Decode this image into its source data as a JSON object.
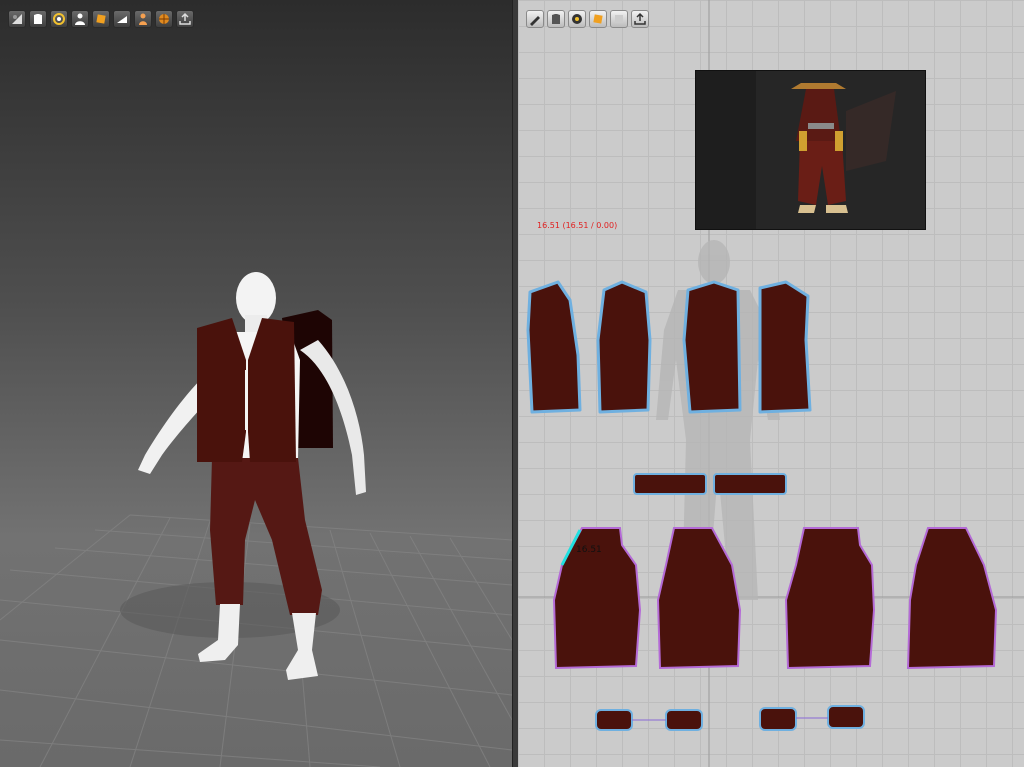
{
  "toolbar3d": {
    "buttons": [
      {
        "name": "select-mesh-icon"
      },
      {
        "name": "select-garment-icon"
      },
      {
        "name": "transform-icon"
      },
      {
        "name": "avatar-icon"
      },
      {
        "name": "fabric-icon"
      },
      {
        "name": "fold-icon"
      },
      {
        "name": "skin-icon"
      },
      {
        "name": "texture-icon"
      },
      {
        "name": "export-icon"
      }
    ]
  },
  "toolbar2d": {
    "buttons": [
      {
        "name": "edit-pattern-icon"
      },
      {
        "name": "transform-pattern-icon"
      },
      {
        "name": "edit-point-icon"
      },
      {
        "name": "fabric-2d-icon"
      },
      {
        "name": "layer-icon"
      },
      {
        "name": "export-2d-icon"
      }
    ]
  },
  "pattern": {
    "measure_readout": "16.51 (16.51 / 0.00)",
    "segment_label": "16.51"
  },
  "colors": {
    "garment": "#4a120c",
    "outline": "#6fb0e0",
    "preview_bg": "#262626"
  }
}
